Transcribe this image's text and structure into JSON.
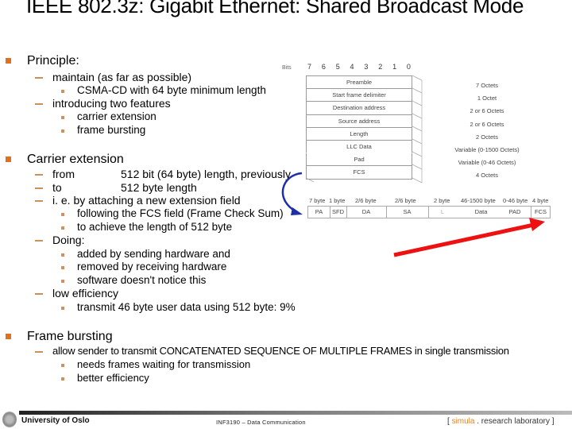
{
  "title": "IEEE 802.3z: Gigabit Ethernet: Shared Broadcast Mode",
  "colors": {
    "bullet": "#e07020",
    "dash": "#c8905a",
    "curved_arrow": "#1c2fa8",
    "red_arrow": "#ee1111",
    "simula_accent": "#e0852a"
  },
  "sections": {
    "principle": {
      "label": "Principle:",
      "items": [
        {
          "text": "maintain (as far as possible)",
          "sub": [
            "CSMA-CD with 64 byte minimum length"
          ]
        },
        {
          "text": "introducing two features",
          "sub": [
            "carrier extension",
            "frame bursting"
          ]
        }
      ]
    },
    "carrier": {
      "label": "Carrier extension",
      "from_key": "from",
      "from_val": "512 bit (64 byte) length, previously",
      "to_key": "to",
      "to_val": "512 byte length",
      "ie": "i. e. by attaching a new extension field",
      "ie_sub": [
        "following the FCS field (Frame Check Sum)",
        "to achieve the length of 512 byte"
      ],
      "doing": "Doing:",
      "doing_sub": [
        "added by sending hardware and",
        "removed by receiving hardware",
        "software doesn't notice this"
      ],
      "eff": "low efficiency",
      "eff_sub": [
        "transmit 46 byte user data using 512 byte: 9%"
      ]
    },
    "bursting": {
      "label": "Frame bursting",
      "item": "allow sender to transmit CONCATENATED SEQUENCE OF MULTIPLE FRAMES in single transmission",
      "sub": [
        "needs frames waiting for transmission",
        "better efficiency"
      ]
    }
  },
  "frame_diagram": {
    "bits_label": "Bits",
    "bit_numbers": [
      "7",
      "6",
      "5",
      "4",
      "3",
      "2",
      "1",
      "0"
    ],
    "fields": [
      "Preamble",
      "Start frame delimiter",
      "Destination address",
      "Source address",
      "Length",
      "LLC Data",
      "Pad",
      "FCS"
    ],
    "sizes": [
      "7 Octets",
      "1 Octet",
      "2 or 6 Octets",
      "2 or 6 Octets",
      "2 Octets",
      "Variable (0-1500 Octets)",
      "Variable (0-46 Octets)",
      "4 Octets"
    ]
  },
  "linear_frame": {
    "cells": [
      {
        "size": "7 byte",
        "name": "PA"
      },
      {
        "size": "1 byte",
        "name": "SFD"
      },
      {
        "size": "2/6 byte",
        "name": "DA"
      },
      {
        "size": "2/6 byte",
        "name": "SA"
      },
      {
        "size": "2 byte",
        "name": "L"
      },
      {
        "size": "46-1500 byte",
        "name": "Data"
      },
      {
        "size": "0-46 byte",
        "name": "PAD"
      },
      {
        "size": "4 byte",
        "name": "FCS"
      }
    ]
  },
  "footer": {
    "university": "University of Oslo",
    "course": "INF3190 – Data Communication",
    "simula_open": "[ ",
    "simula_name": "simula",
    "simula_rest": " . research laboratory ]"
  }
}
